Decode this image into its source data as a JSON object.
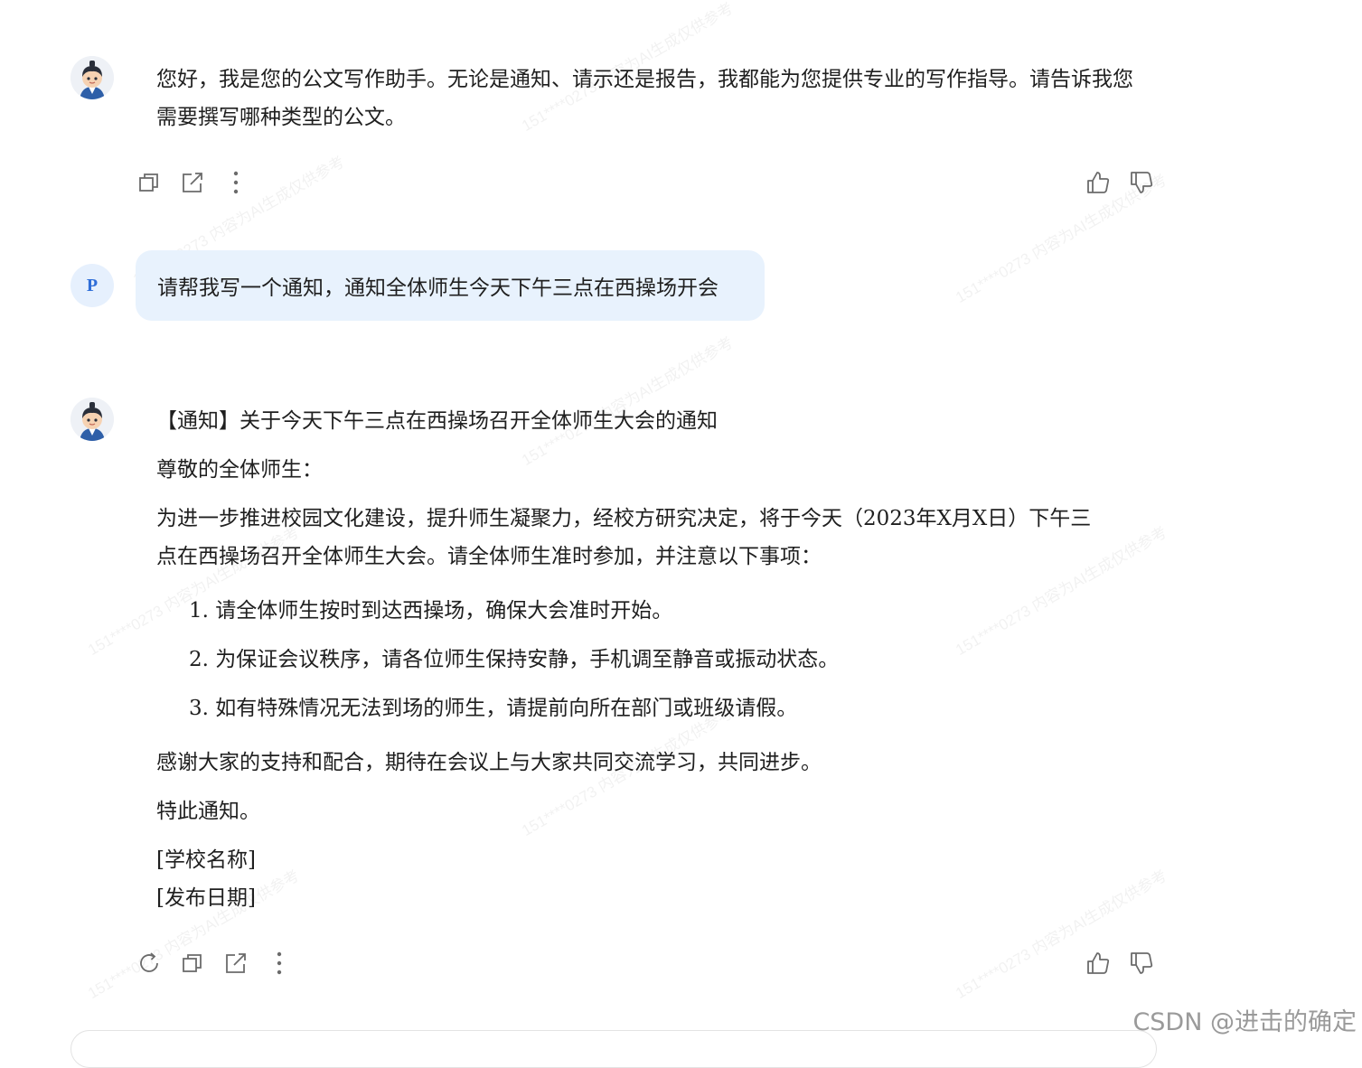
{
  "conversation": {
    "bot_greeting": "您好，我是您的公文写作助手。无论是通知、请示还是报告，我都能为您提供专业的写作指导。请告诉我您需要撰写哪种类型的公文。",
    "user_avatar_letter": "P",
    "user_message": "请帮我写一个通知，通知全体师生今天下午三点在西操场开会",
    "reply": {
      "title": "【通知】关于今天下午三点在西操场召开全体师生大会的通知",
      "salutation": "尊敬的全体师生：",
      "body_line1": "为进一步推进校园文化建设，提升师生凝聚力，经校方研究决定，将于今天（2023年X月X日）下午三",
      "body_line2": "点在西操场召开全体师生大会。请全体师生准时参加，并注意以下事项：",
      "items": [
        "1. 请全体师生按时到达西操场，确保大会准时开始。",
        "2. 为保证会议秩序，请各位师生保持安静，手机调至静音或振动状态。",
        "3. 如有特殊情况无法到场的师生，请提前向所在部门或班级请假。"
      ],
      "thanks": "感谢大家的支持和配合，期待在会议上与大家共同交流学习，共同进步。",
      "closing": "特此通知。",
      "school_placeholder": "[学校名称]",
      "date_placeholder": "[发布日期]"
    }
  },
  "icons": {
    "copy": "copy-icon",
    "share": "share-icon",
    "more": "more-vertical-icon",
    "thumbs_up": "thumbs-up-icon",
    "thumbs_down": "thumbs-down-icon",
    "regenerate": "regenerate-icon"
  },
  "watermark_text": "151****0273 内容为AI生成仅供参考",
  "site_watermark": "CSDN @进击的确定",
  "colors": {
    "user_bubble": "#e8f2fd",
    "icon": "#6b6b6b",
    "user_avatar_text": "#2f6ed8"
  }
}
